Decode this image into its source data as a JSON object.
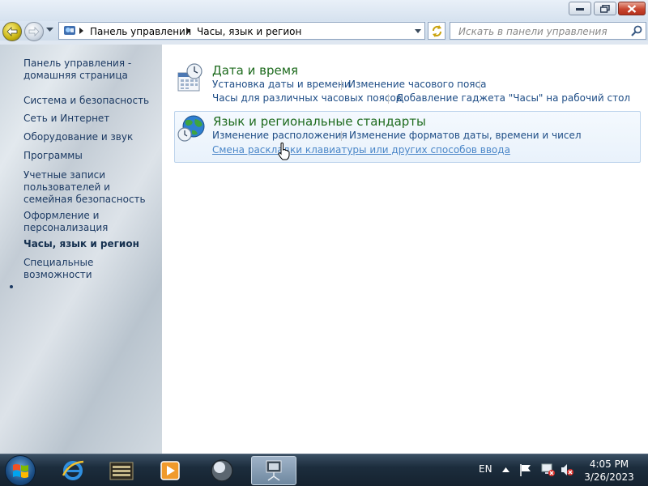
{
  "address_bar": {
    "crumbs": [
      "Панель управления",
      "Часы, язык и регион"
    ]
  },
  "search": {
    "placeholder": "Искать в панели управления"
  },
  "sidebar": {
    "home": "Панель управления - домашняя страница",
    "items": [
      "Система и безопасность",
      "Сеть и Интернет",
      "Оборудование и звук",
      "Программы",
      "Учетные записи пользователей и семейная безопасность",
      "Оформление и персонализация",
      "Часы, язык и регион",
      "Специальные возможности"
    ],
    "active_index": 6
  },
  "categories": [
    {
      "title": "Дата и время",
      "links": [
        "Установка даты и времени",
        "Изменение часового пояса",
        "Часы для различных часовых поясов",
        "Добавление гаджета \"Часы\" на рабочий стол"
      ]
    },
    {
      "title": "Язык и региональные стандарты",
      "links": [
        "Изменение расположения",
        "Изменение форматов даты, времени и чисел",
        "Смена раскладки клавиатуры или других способов ввода"
      ]
    }
  ],
  "taskbar": {
    "language": "EN",
    "time": "4:05 PM",
    "date": "3/26/2023"
  },
  "icons": {
    "window": [
      "minimize-icon",
      "maximize-icon",
      "close-icon"
    ],
    "nav": [
      "back-arrow-icon",
      "forward-arrow-icon",
      "control-panel-icon",
      "refresh-icon",
      "search-icon"
    ],
    "taskbar": [
      "windows-logo-icon",
      "internet-explorer-icon",
      "file-manager-icon",
      "media-player-icon",
      "globe-orb-icon",
      "control-panel-icon"
    ],
    "tray": [
      "show-hidden-icons-arrow",
      "action-center-flag-icon",
      "network-icon",
      "volume-muted-icon"
    ]
  },
  "colors": {
    "category_title": "#1e6b1e",
    "link": "#1e4d86",
    "hover_link": "#4a86c8",
    "sidebar_text": "#1c3a63"
  }
}
